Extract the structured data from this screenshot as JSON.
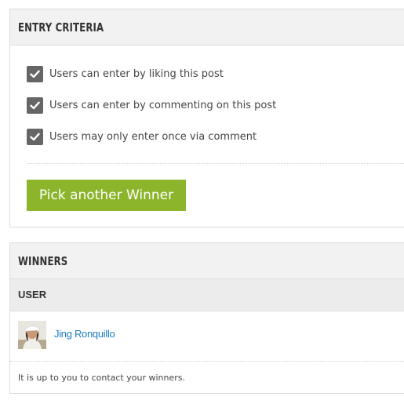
{
  "entry_criteria": {
    "title": "ENTRY CRITERIA",
    "items": [
      {
        "label": "Users can enter by liking this post",
        "checked": true
      },
      {
        "label": "Users can enter by commenting on this post",
        "checked": true
      },
      {
        "label": "Users may only enter once via comment",
        "checked": true
      }
    ],
    "pick_button_label": "Pick another Winner"
  },
  "winners": {
    "title": "WINNERS",
    "column_header": "USER",
    "rows": [
      {
        "name": "Jing Ronquillo",
        "avatar_icon": "user-avatar"
      }
    ],
    "note": "It is up to you to contact your winners."
  },
  "colors": {
    "accent_button": "#8cb52c",
    "link": "#1a7fc1",
    "checkbox": "#666666"
  }
}
